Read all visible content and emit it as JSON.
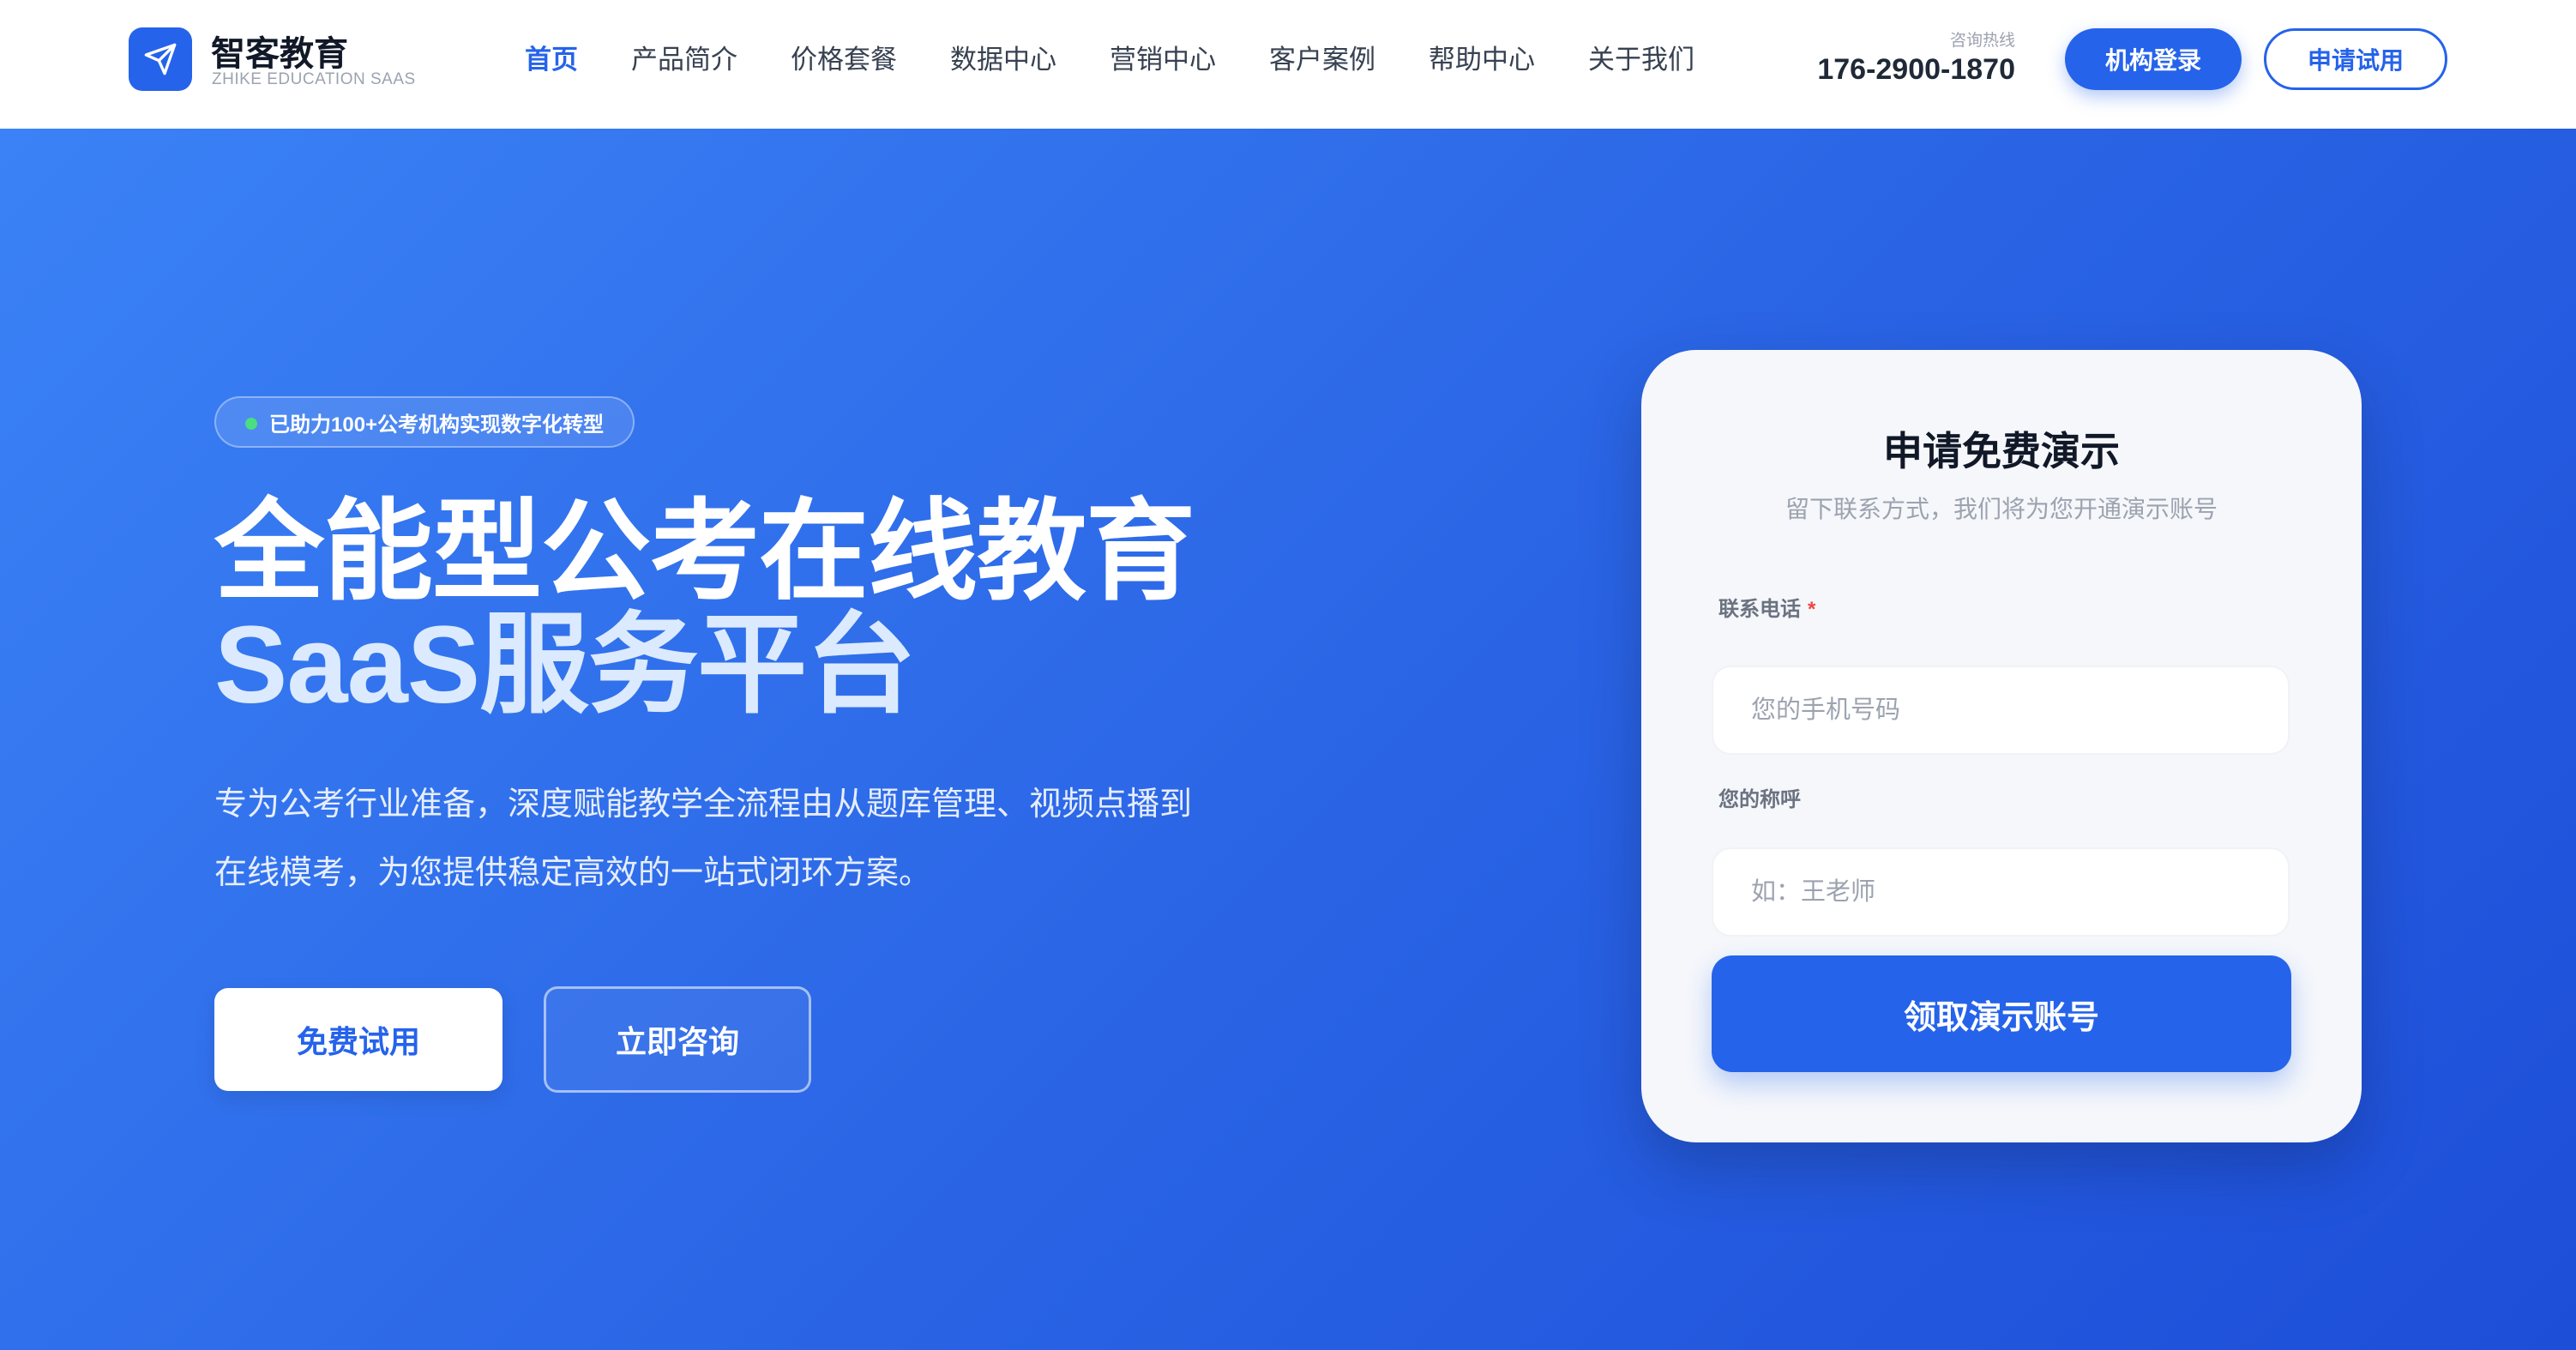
{
  "brand": {
    "name": "智客教育",
    "sub": "ZHIKE EDUCATION SAAS",
    "logo_icon": "paper-plane-icon"
  },
  "nav": {
    "items": [
      {
        "label": "首页",
        "active": true
      },
      {
        "label": "产品简介",
        "active": false
      },
      {
        "label": "价格套餐",
        "active": false
      },
      {
        "label": "数据中心",
        "active": false
      },
      {
        "label": "营销中心",
        "active": false
      },
      {
        "label": "客户案例",
        "active": false
      },
      {
        "label": "帮助中心",
        "active": false
      },
      {
        "label": "关于我们",
        "active": false
      }
    ]
  },
  "hotline": {
    "label": "咨询热线",
    "number": "176-2900-1870"
  },
  "header_buttons": {
    "login": "机构登录",
    "trial": "申请试用"
  },
  "hero": {
    "badge": "已助力100+公考机构实现数字化转型",
    "title_line1": "全能型公考在线教育",
    "title_line2": "SaaS服务平台",
    "description": "专为公考行业准备，深度赋能教学全流程由从题库管理、视频点播到在线模考，为您提供稳定高效的一站式闭环方案。",
    "btn_free": "免费试用",
    "btn_consult": "立即咨询"
  },
  "form": {
    "title": "申请免费演示",
    "subtitle": "留下联系方式，我们将为您开通演示账号",
    "phone_label": "联系电话",
    "phone_required": "*",
    "phone_placeholder": "您的手机号码",
    "name_label": "您的称呼",
    "name_placeholder": "如：王老师",
    "submit": "领取演示账号"
  },
  "colors": {
    "primary": "#2563eb",
    "hero_gradient_start": "#3b82f6",
    "hero_gradient_end": "#1d4ed8",
    "badge_dot": "#4ade80",
    "required": "#ef4444"
  }
}
